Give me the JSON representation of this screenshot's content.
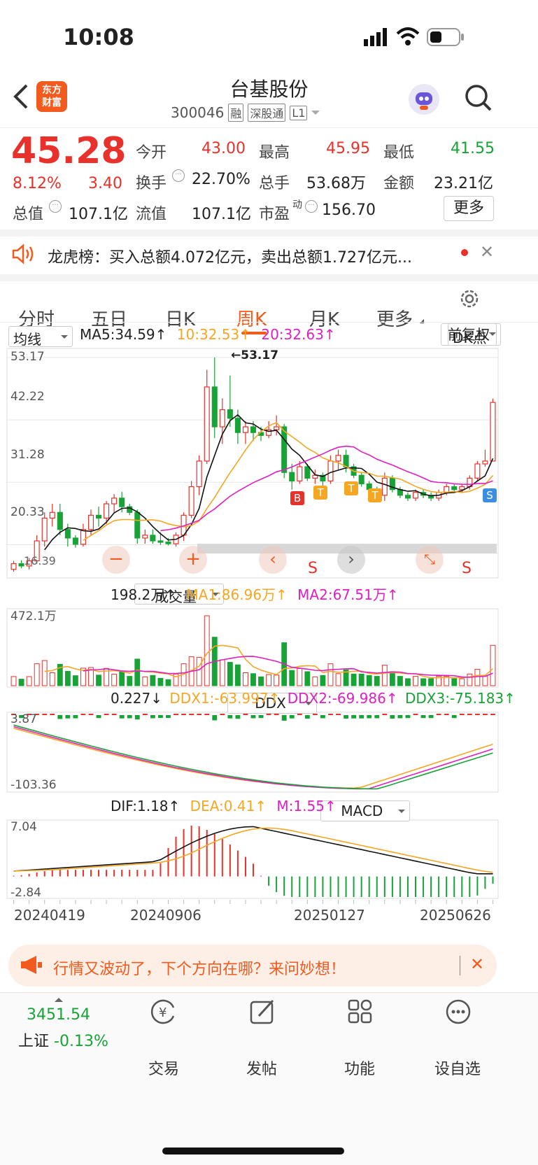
{
  "status": {
    "time": "10:08"
  },
  "header": {
    "logo": "东方财富",
    "title": "台基股份",
    "code": "300046",
    "tags": [
      "融",
      "深股通",
      "L1"
    ]
  },
  "quote": {
    "price": "45.28",
    "pct": "8.12%",
    "chg": "3.40",
    "row1": [
      {
        "label": "今开",
        "value": "43.00",
        "color": "red"
      },
      {
        "label": "最高",
        "value": "45.95",
        "color": "red"
      },
      {
        "label": "最低",
        "value": "41.55",
        "color": "green"
      }
    ],
    "row2": [
      {
        "label": "换手",
        "value": "22.70%"
      },
      {
        "label": "总手",
        "value": "53.68万"
      },
      {
        "label": "金额",
        "value": "23.21亿"
      }
    ],
    "row3": [
      {
        "label": "总值",
        "value": "107.1亿"
      },
      {
        "label": "流值",
        "value": "107.1亿"
      },
      {
        "label": "市盈",
        "sup": "动",
        "value": "156.70"
      }
    ],
    "more": "更多"
  },
  "notice": {
    "label": "龙虎榜：",
    "text": "买入总额4.072亿元，卖出总额1.727亿元..."
  },
  "tabs": [
    "分时",
    "五日",
    "日K",
    "周K",
    "月K",
    "更多"
  ],
  "activeTab": "周K",
  "ma": {
    "selector": "均线",
    "ma5": "MA5:34.59",
    "ma10": "10:32.53",
    "ma20": "20:32.63",
    "dk": "DK点",
    "fq": "前复权"
  },
  "kline": {
    "yticks": [
      "53.17",
      "42.22",
      "31.28",
      "20.33"
    ],
    "high": "←53.17",
    "bottomLabel": "16.39",
    "markers": [
      "B",
      "T",
      "T",
      "T",
      "S"
    ],
    "s_markers": [
      "S",
      "S"
    ]
  },
  "vol": {
    "selector": "成交量",
    "value": "198.2万",
    "ma1": "MA1:86.96万",
    "ma2": "MA2:67.51万",
    "ymax": "472.1万"
  },
  "ddx": {
    "selector": "DDX",
    "value": "0.227",
    "ddx1": "DDX1:-63.997",
    "ddx2": "DDX2:-69.986",
    "ddx3": "DDX3:-75.183",
    "ymax": "3.87",
    "ymin": "-103.36"
  },
  "macd": {
    "selector": "MACD",
    "dif": "DIF:1.18",
    "dea": "DEA:0.41",
    "m": "M:1.55",
    "ymax": "7.04",
    "ymin": "-2.84"
  },
  "dates": [
    "20240419",
    "20240906",
    "20250127",
    "20250626"
  ],
  "banner": {
    "text": "行情又波动了，下个方向在哪？来问妙想！"
  },
  "index": {
    "value": "3451.54",
    "name": "上证",
    "pct": "-0.13%"
  },
  "bottomNav": [
    "交易",
    "发帖",
    "功能",
    "设自选"
  ],
  "colors": {
    "up": "#e8312a",
    "down": "#18a336",
    "ma10": "#f5a623",
    "ma20": "#e020c0",
    "accent": "#f25a1e"
  },
  "chart_data": {
    "type": "candlestick",
    "period": "weekly",
    "ohlc": [
      [
        16,
        17.5,
        15.6,
        17
      ],
      [
        17,
        17.6,
        16.2,
        16.6
      ],
      [
        16.6,
        18,
        16,
        17.5
      ],
      [
        17.5,
        22,
        17,
        21
      ],
      [
        21,
        26,
        20,
        25
      ],
      [
        25,
        27.5,
        23.5,
        26
      ],
      [
        26,
        27.5,
        22,
        23
      ],
      [
        23,
        24,
        20,
        21.5
      ],
      [
        21.5,
        22,
        19.8,
        20.4
      ],
      [
        20.4,
        24,
        20,
        23
      ],
      [
        23,
        26.5,
        22,
        25.5
      ],
      [
        25.5,
        27,
        23.5,
        25
      ],
      [
        25,
        28,
        24,
        27.5
      ],
      [
        27.5,
        29.2,
        26,
        28.5
      ],
      [
        28.5,
        29.6,
        26,
        27
      ],
      [
        27,
        27.5,
        25.5,
        26
      ],
      [
        26,
        26.5,
        20.5,
        21.5
      ],
      [
        21.5,
        23,
        20.5,
        22
      ],
      [
        22,
        23,
        20.5,
        21
      ],
      [
        21,
        22.5,
        20.3,
        20.8
      ],
      [
        20.8,
        21.5,
        20.2,
        20.5
      ],
      [
        20.5,
        22.5,
        20,
        22
      ],
      [
        22,
        26,
        21,
        25.5
      ],
      [
        25.5,
        31.5,
        25,
        30.5
      ],
      [
        30.5,
        36,
        29,
        35
      ],
      [
        35,
        51,
        34.5,
        48
      ],
      [
        48,
        53.17,
        39,
        41
      ],
      [
        41,
        46,
        38,
        44
      ],
      [
        44,
        50,
        41,
        42.5
      ],
      [
        42.5,
        44,
        38,
        40
      ],
      [
        40,
        42,
        38,
        41
      ],
      [
        41,
        42,
        38.5,
        40
      ],
      [
        40,
        41,
        38.5,
        39.5
      ],
      [
        39.5,
        42,
        39,
        40.5
      ],
      [
        40.5,
        43,
        39.5,
        41
      ],
      [
        41,
        41.5,
        32,
        33
      ],
      [
        33,
        34.5,
        30,
        31.5
      ],
      [
        31.5,
        35,
        31,
        34
      ],
      [
        34,
        34.5,
        31.5,
        32
      ],
      [
        32,
        33.5,
        31,
        32.5
      ],
      [
        32.5,
        33,
        30.5,
        31.5
      ],
      [
        31.5,
        36,
        31,
        35
      ],
      [
        35,
        37,
        33.5,
        36
      ],
      [
        36,
        37,
        33,
        34
      ],
      [
        34,
        34.5,
        32,
        32.5
      ],
      [
        32.5,
        33,
        30.5,
        31
      ],
      [
        31,
        31.5,
        29,
        30
      ],
      [
        30,
        30.5,
        28.5,
        29
      ],
      [
        29,
        33,
        28,
        32
      ],
      [
        32,
        32.5,
        29.5,
        30
      ],
      [
        30,
        30.5,
        28.5,
        29
      ],
      [
        29,
        29.5,
        28,
        28.5
      ],
      [
        28.5,
        30,
        28,
        29.5
      ],
      [
        29.5,
        30,
        28.5,
        29
      ],
      [
        29,
        29.5,
        28,
        28.5
      ],
      [
        28.5,
        30,
        28,
        29.5
      ],
      [
        29.5,
        31,
        29,
        30.5
      ],
      [
        30.5,
        31,
        29.5,
        30
      ],
      [
        30,
        31,
        29.5,
        30.5
      ],
      [
        30.5,
        32.5,
        30,
        32
      ],
      [
        32,
        35,
        31.5,
        34.5
      ],
      [
        34.5,
        37,
        34,
        35
      ],
      [
        35,
        45.95,
        41.55,
        45.28
      ]
    ],
    "ma5_last": 34.59,
    "ma10_last": 32.53,
    "ma20_last": 32.63
  }
}
